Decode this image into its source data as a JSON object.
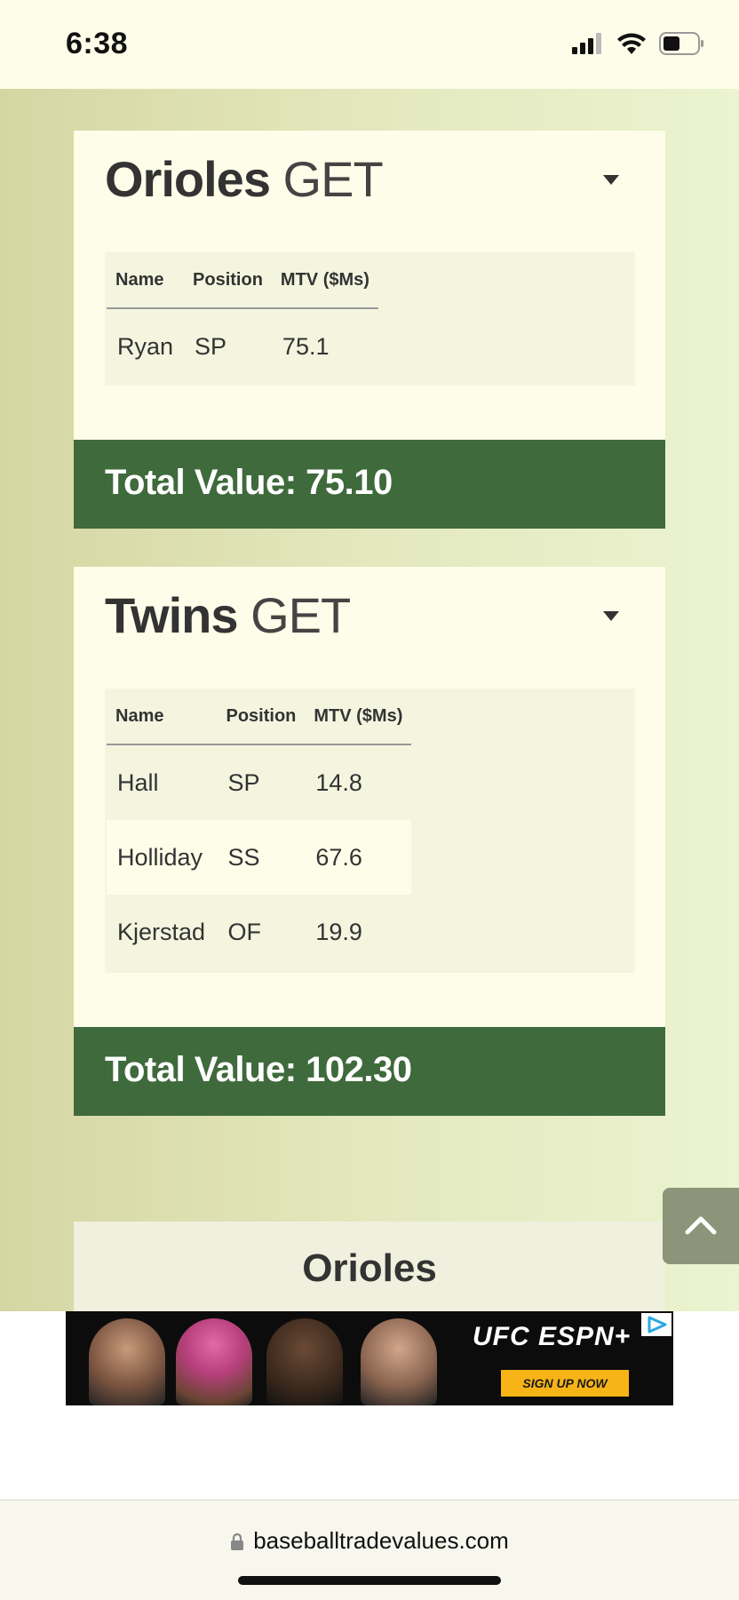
{
  "status_bar": {
    "time": "6:38",
    "icons": [
      "cellular-signal-icon",
      "wifi-icon",
      "battery-icon"
    ]
  },
  "trades": [
    {
      "team": "Orioles",
      "action": "GET",
      "columns": [
        "Name",
        "Position",
        "MTV ($Ms)"
      ],
      "players": [
        {
          "name": "Ryan",
          "position": "SP",
          "mtv": "75.1"
        }
      ],
      "total": "Total Value: 75.10"
    },
    {
      "team": "Twins",
      "action": "GET",
      "columns": [
        "Name",
        "Position",
        "MTV ($Ms)"
      ],
      "players": [
        {
          "name": "Hall",
          "position": "SP",
          "mtv": "14.8"
        },
        {
          "name": "Holliday",
          "position": "SS",
          "mtv": "67.6"
        },
        {
          "name": "Kjerstad",
          "position": "OF",
          "mtv": "19.9"
        }
      ],
      "total": "Total Value: 102.30"
    }
  ],
  "next_section": {
    "title": "Orioles"
  },
  "ad": {
    "brand": "UFC ESPN+",
    "cta": "SIGN UP NOW",
    "icons": [
      "ad-choices-icon"
    ]
  },
  "browser": {
    "url": "baseballtradevalues.com",
    "icons": [
      "lock-icon"
    ]
  },
  "colors": {
    "total_bar": "#3f6a3c",
    "card_bg": "#fdfde9",
    "table_bg": "#f4f5df",
    "back_to_top": "#8c957a"
  }
}
